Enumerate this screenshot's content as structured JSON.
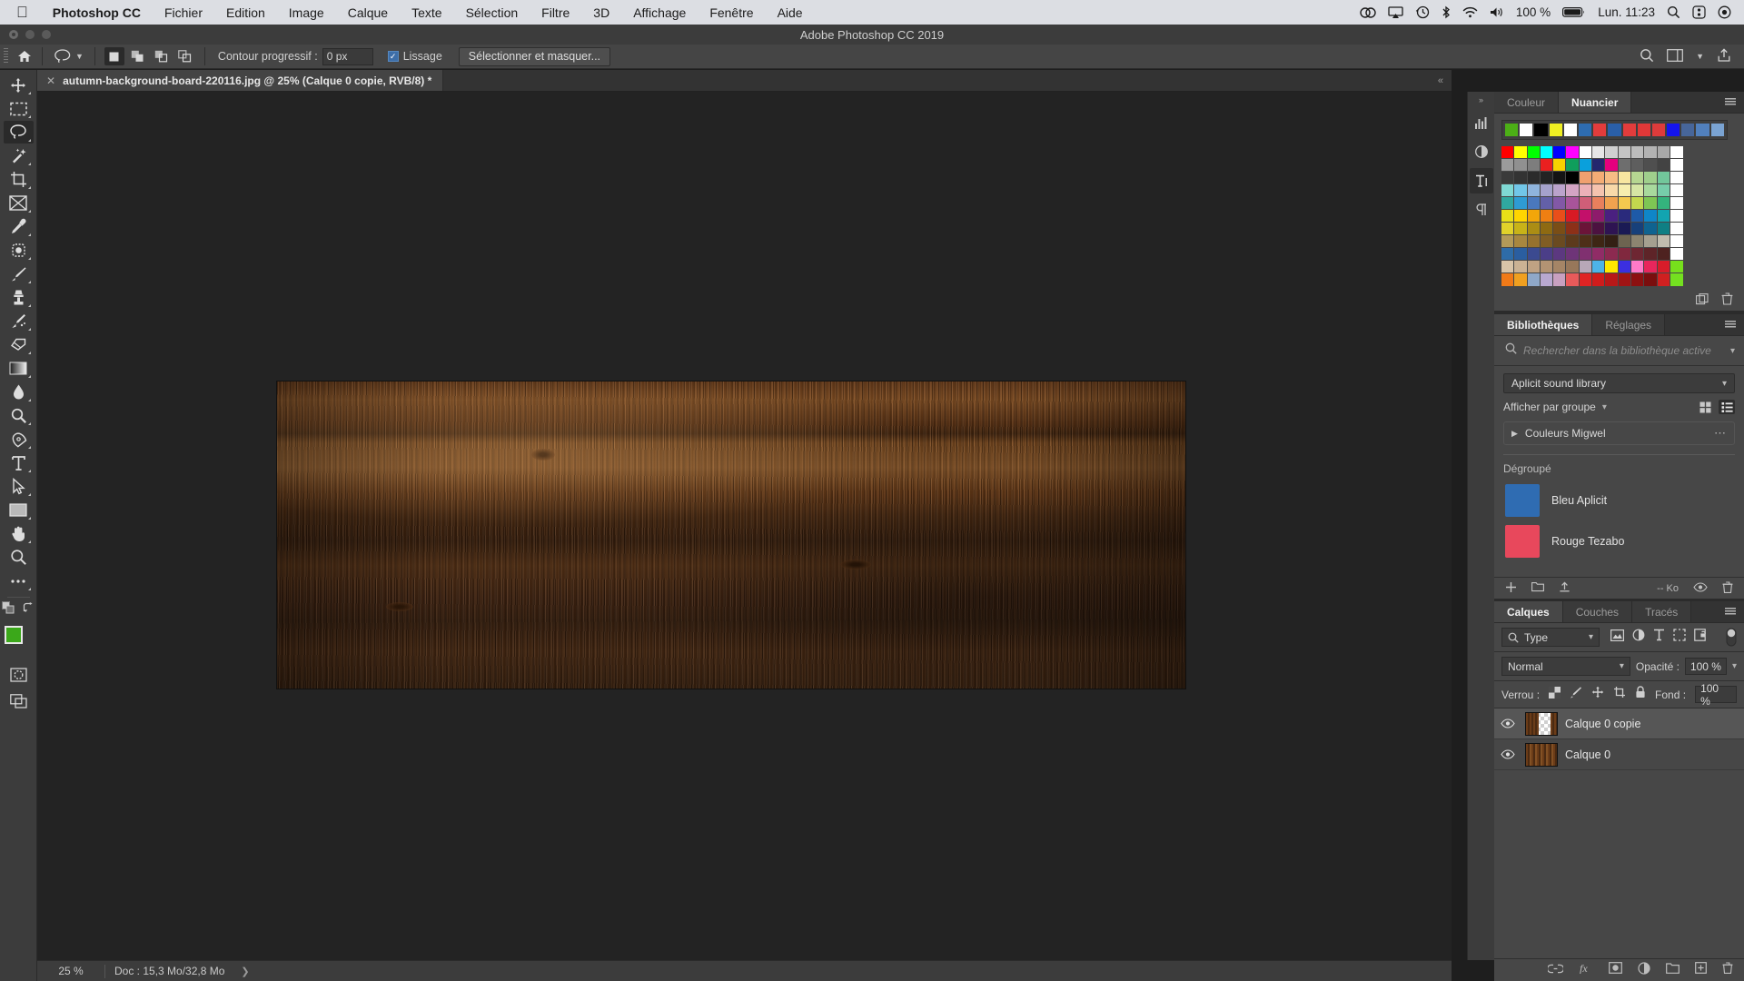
{
  "macos_menubar": {
    "apple_icon": "apple-icon",
    "items": [
      {
        "label": "Photoshop CC",
        "bold": true
      },
      {
        "label": "Fichier",
        "bold": false
      },
      {
        "label": "Edition",
        "bold": false
      },
      {
        "label": "Image",
        "bold": false
      },
      {
        "label": "Calque",
        "bold": false
      },
      {
        "label": "Texte",
        "bold": false
      },
      {
        "label": "Sélection",
        "bold": false
      },
      {
        "label": "Filtre",
        "bold": false
      },
      {
        "label": "3D",
        "bold": false
      },
      {
        "label": "Affichage",
        "bold": false
      },
      {
        "label": "Fenêtre",
        "bold": false
      },
      {
        "label": "Aide",
        "bold": false
      }
    ],
    "status_icons": [
      "creative-cloud-icon",
      "airplay-icon",
      "time-machine-icon",
      "bluetooth-icon",
      "wifi-icon",
      "volume-icon"
    ],
    "battery_percent": "100 %",
    "battery_icon": "battery-icon",
    "clock": "Lun. 11:23",
    "spotlight_icon": "search-icon",
    "control_center_icon": "control-center-icon",
    "siri_icon": "siri-icon"
  },
  "window": {
    "title": "Adobe Photoshop CC 2019"
  },
  "options_bar": {
    "home_icon": "home-icon",
    "tool_icon": "lasso-tool-icon",
    "tool_chevron": "chevron-down-icon",
    "selection_modes": [
      {
        "name": "new-selection",
        "active": true
      },
      {
        "name": "add-to-selection",
        "active": false
      },
      {
        "name": "subtract-from-selection",
        "active": false
      },
      {
        "name": "intersect-selection",
        "active": false
      }
    ],
    "feather_label": "Contour progressif :",
    "feather_value": "0 px",
    "antialias_label": "Lissage",
    "antialias_checked": true,
    "select_and_mask_label": "Sélectionner et masquer...",
    "right_icons": [
      "search-icon",
      "workspace-icon",
      "chevron-down-icon",
      "share-icon"
    ]
  },
  "document_tab": {
    "close_icon": "close-icon",
    "title": "autumn-background-board-220116.jpg @ 25% (Calque 0 copie, RVB/8) *"
  },
  "toolbar": {
    "tools": [
      {
        "name": "move-tool",
        "active": false
      },
      {
        "name": "rectangular-marquee-tool",
        "active": false
      },
      {
        "name": "lasso-tool",
        "active": true
      },
      {
        "name": "quick-selection-tool",
        "active": false
      },
      {
        "name": "crop-tool",
        "active": false
      },
      {
        "name": "frame-tool",
        "active": false
      },
      {
        "name": "eyedropper-tool",
        "active": false
      },
      {
        "name": "spot-healing-brush-tool",
        "active": false
      },
      {
        "name": "brush-tool",
        "active": false
      },
      {
        "name": "clone-stamp-tool",
        "active": false
      },
      {
        "name": "history-brush-tool",
        "active": false
      },
      {
        "name": "eraser-tool",
        "active": false
      },
      {
        "name": "gradient-tool",
        "active": false
      },
      {
        "name": "blur-tool",
        "active": false
      },
      {
        "name": "dodge-tool",
        "active": false
      },
      {
        "name": "pen-tool",
        "active": false
      },
      {
        "name": "horizontal-type-tool",
        "active": false
      },
      {
        "name": "path-selection-tool",
        "active": false
      },
      {
        "name": "rectangle-tool",
        "active": false
      },
      {
        "name": "hand-tool",
        "active": false
      },
      {
        "name": "zoom-tool",
        "active": false
      },
      {
        "name": "edit-toolbar-ellipsis",
        "active": false
      }
    ],
    "default_colors_icon": "default-colors-icon",
    "swap-colors_icon": "swap-colors-icon",
    "foreground_color": "#3ba81a",
    "background_color": "#2f6cb2",
    "quick_mask_icon": "quick-mask-icon",
    "screen_mode_icon": "screen-mode-icon"
  },
  "canvas": {
    "zoom": "25 %",
    "artboard_name": "wood-board-image"
  },
  "status_bar": {
    "zoom": "25 %",
    "doc_info": "Doc : 15,3 Mo/32,8 Mo",
    "expand_icon": "chevron-right-icon"
  },
  "icon_rail": {
    "collapse_icon": "collapse-panels-icon",
    "items": [
      {
        "name": "histogram-icon",
        "selected": false
      },
      {
        "name": "adjustments-icon",
        "selected": false
      },
      {
        "name": "character-icon",
        "selected": true
      },
      {
        "name": "paragraph-icon",
        "selected": false
      }
    ]
  },
  "color_panel": {
    "tabs": [
      {
        "label": "Couleur",
        "active": false
      },
      {
        "label": "Nuancier",
        "active": true
      }
    ],
    "menu_icon": "panel-menu-icon",
    "recent_swatches": [
      "#4caf16",
      "#ffffff",
      "#000000",
      "#eeee22",
      "#ffffff",
      "#2e6cb0",
      "#e23c3c",
      "#2a5fa8",
      "#e23c3c",
      "#e03838",
      "#dd3b3b",
      "#1414ee",
      "#47669a",
      "#5180bd",
      "#7aa3d2"
    ],
    "swatch_rows": [
      [
        "#ff0000",
        "#ffff00",
        "#00ff00",
        "#00ffff",
        "#0000ff",
        "#ff00ff",
        "#ffffff",
        "#e6e6e6",
        "#d0d0d0",
        "#c4c4c4",
        "#bcbcbc",
        "#b2b2b2",
        "#a8a8a8",
        "#ffffff"
      ],
      [
        "#9b9b9b",
        "#909090",
        "#7d7d7d",
        "#ea2020",
        "#f6d200",
        "#0f9e5c",
        "#0aa0dc",
        "#24276e",
        "#e5007e",
        "#6e6e6e",
        "#5e5e5e",
        "#4f4f4f",
        "#434343",
        "#ffffff"
      ],
      [
        "#3a3a3a",
        "#333333",
        "#2b2b2b",
        "#232323",
        "#141414",
        "#000000",
        "#f0a070",
        "#f4ac75",
        "#f6bc84",
        "#f7e6a0",
        "#b6d691",
        "#9fcf8c",
        "#72c79b",
        "#ffffff"
      ],
      [
        "#7fd9d4",
        "#71c6e8",
        "#8fb4dd",
        "#a5a2cc",
        "#bba3cc",
        "#d4a4c4",
        "#ecb0b8",
        "#f5c3ae",
        "#f8d9a9",
        "#f6eeae",
        "#d6e5a4",
        "#a8d99d",
        "#76cdaa",
        "#ffffff"
      ],
      [
        "#30a8a0",
        "#2e9bd4",
        "#4a78bd",
        "#6360a8",
        "#8258a6",
        "#a8549a",
        "#d05e78",
        "#e8805d",
        "#f0a24f",
        "#f3c94f",
        "#c3d74e",
        "#7ec554",
        "#34b37d",
        "#ffffff"
      ],
      [
        "#e8e018",
        "#ffd500",
        "#f2a60a",
        "#ee7f12",
        "#e84e1a",
        "#d81a24",
        "#c3106a",
        "#8e1b6b",
        "#4a2080",
        "#2a2a7c",
        "#1e5aa8",
        "#0f86c8",
        "#12a4b0",
        "#ffffff"
      ],
      [
        "#e1d22a",
        "#c8b318",
        "#ab8d14",
        "#8e6a12",
        "#7a4e16",
        "#8c3018",
        "#6b1438",
        "#4c1240",
        "#2e1452",
        "#1a1a54",
        "#17407a",
        "#0f6390",
        "#0f7f84",
        "#ffffff"
      ],
      [
        "#b39a58",
        "#a8873f",
        "#96722e",
        "#805d24",
        "#6a4a20",
        "#5c3a1c",
        "#4e2f18",
        "#3e2614",
        "#332014",
        "#6d6450",
        "#8c8470",
        "#a5a090",
        "#c0bcae",
        "#ffffff"
      ],
      [
        "#2e6ca8",
        "#2a5ea0",
        "#3b4a90",
        "#4b3e88",
        "#5c3880",
        "#6e3478",
        "#803070",
        "#902c66",
        "#8c2a50",
        "#80283e",
        "#6e2632",
        "#5e2428",
        "#4e2220",
        "#ffffff"
      ],
      [
        "#d9c4a8",
        "#cbb294",
        "#bfa283",
        "#b39373",
        "#a58566",
        "#97775a",
        "#b8a8b8",
        "#4db3e8",
        "#ffe800",
        "#3b2fe0",
        "#ff7ac8",
        "#e8265c",
        "#d81c2a",
        "#77e01c"
      ],
      [
        "#f07a18",
        "#f0a020",
        "#8fa8c8",
        "#b8a8d0",
        "#c8a0c0",
        "#e85a5a",
        "#e02424",
        "#d01c1c",
        "#b81818",
        "#a01414",
        "#8c1010",
        "#7a0e0e",
        "#d02020",
        "#74e020"
      ]
    ],
    "footer_icons": [
      "new-swatch-icon",
      "delete-swatch-icon"
    ]
  },
  "libraries_panel": {
    "tabs": [
      {
        "label": "Bibliothèques",
        "active": true
      },
      {
        "label": "Réglages",
        "active": false
      }
    ],
    "menu_icon": "panel-menu-icon",
    "search_icon": "search-icon",
    "search_placeholder": "Rechercher dans la bibliothèque active",
    "search_chevron": "chevron-down-icon",
    "selected_library": "Aplicit sound library",
    "library_chevron": "chevron-down-icon",
    "group_by_label": "Afficher par groupe",
    "group_by_chevron": "chevron-down-icon",
    "view_grid_icon": "grid-view-icon",
    "view_list_icon": "list-view-icon",
    "group_item": {
      "disclosure_icon": "triangle-right-icon",
      "label": "Couleurs Migwel",
      "more_icon": "more-options-icon"
    },
    "ungrouped_label": "Dégroupé",
    "assets": [
      {
        "name": "Bleu Aplicit",
        "color": "#2f6cb2"
      },
      {
        "name": "Rouge Tezabo",
        "color": "#e8485c"
      }
    ],
    "footer": {
      "add_icon": "plus-icon",
      "folder_icon": "folder-icon",
      "upload_icon": "upload-icon",
      "size_label": "-- Ko",
      "visibility_icon": "eye-icon",
      "delete_icon": "trash-icon"
    }
  },
  "layers_panel": {
    "tabs": [
      {
        "label": "Calques",
        "active": true
      },
      {
        "label": "Couches",
        "active": false
      },
      {
        "label": "Tracés",
        "active": false
      }
    ],
    "menu_icon": "panel-menu-icon",
    "filter": {
      "search_icon": "search-icon",
      "type_label": "Type",
      "chevron": "chevron-down-icon",
      "filter_icons": [
        "pixel-filter-icon",
        "adjustment-filter-icon",
        "type-filter-icon",
        "shape-filter-icon",
        "smartobject-filter-icon"
      ],
      "toggle_name": "filter-toggle"
    },
    "blend_mode": "Normal",
    "blend_chevron": "chevron-down-icon",
    "opacity_label": "Opacité :",
    "opacity_value": "100 %",
    "opacity_chevron": "chevron-down-icon",
    "lock_label": "Verrou :",
    "lock_icons": [
      "lock-transparent-pixels-icon",
      "lock-image-pixels-icon",
      "lock-position-icon",
      "lock-artboard-icon",
      "lock-all-icon"
    ],
    "fill_label": "Fond :",
    "fill_value": "100 %",
    "fill_chevron": "chevron-down-icon",
    "layers": [
      {
        "name": "Calque 0 copie",
        "visible": true,
        "selected": true,
        "thumb": "transparent-with-wood-ends"
      },
      {
        "name": "Calque 0",
        "visible": true,
        "selected": false,
        "thumb": "wood"
      }
    ],
    "footer_icons": [
      "link-layers-icon",
      "layer-style-icon",
      "layer-mask-icon",
      "adjustment-layer-icon",
      "new-group-icon",
      "new-layer-icon",
      "delete-layer-icon"
    ]
  }
}
